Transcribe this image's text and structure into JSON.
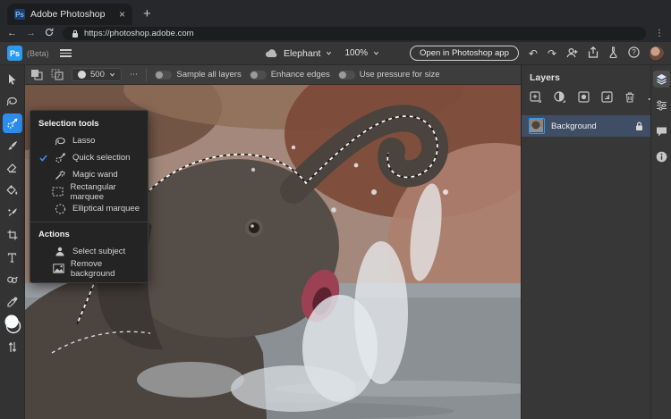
{
  "browser": {
    "tab_title": "Adobe Photoshop",
    "close_glyph": "×",
    "new_tab_glyph": "+",
    "url": "https://photoshop.adobe.com"
  },
  "ps_header": {
    "logo": "Ps",
    "beta": "(Beta)",
    "doc_name": "Elephant",
    "zoom": "100%",
    "open_button": "Open in Photoshop app"
  },
  "options_bar": {
    "brush_size": "500",
    "toggles": [
      {
        "label": "Sample all layers",
        "on": false
      },
      {
        "label": "Enhance edges",
        "on": false
      },
      {
        "label": "Use pressure for size",
        "on": false
      }
    ]
  },
  "tools_flyout": {
    "selection_header": "Selection tools",
    "items": [
      {
        "label": "Lasso",
        "selected": false
      },
      {
        "label": "Quick selection",
        "selected": true
      },
      {
        "label": "Magic wand",
        "selected": false
      },
      {
        "label": "Rectangular marquee",
        "selected": false
      },
      {
        "label": "Elliptical marquee",
        "selected": false
      }
    ],
    "actions_header": "Actions",
    "actions": [
      {
        "label": "Select subject"
      },
      {
        "label": "Remove background"
      }
    ]
  },
  "layers_panel": {
    "title": "Layers",
    "items": [
      {
        "name": "Background",
        "locked": true,
        "selected": true
      }
    ]
  },
  "tool_names": [
    "move",
    "lasso",
    "quick-selection",
    "brush",
    "eraser",
    "fill",
    "healing-brush",
    "crop",
    "type",
    "clone-stamp",
    "eyedropper",
    "color-swatches",
    "swap-arrows"
  ],
  "colors": {
    "accent_blue": "#2d9bf0",
    "active_tool_bg": "#2e8ceb",
    "selected_layer_row": "#3f4e64",
    "logo_bg": "#2b9af3"
  }
}
